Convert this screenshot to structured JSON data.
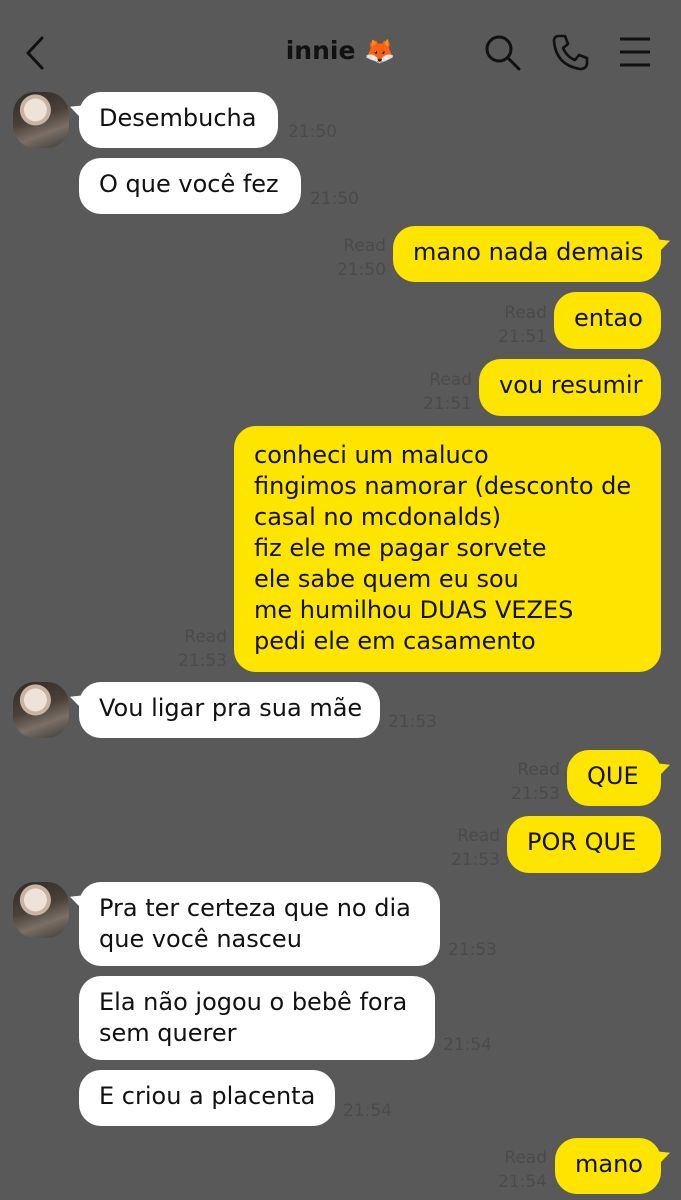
{
  "header": {
    "title": "innie 🦊",
    "icons": [
      "back-arrow-icon",
      "search-icon",
      "phone-icon",
      "menu-icon"
    ]
  },
  "colors": {
    "background": "#595959",
    "incoming": "#ffffff",
    "outgoing": "#fee500"
  },
  "messages": [
    {
      "side": "in",
      "lines": [
        "Desembucha"
      ],
      "time": "21:50"
    },
    {
      "side": "in",
      "lines": [
        "O que você fez"
      ],
      "time": "21:50"
    },
    {
      "side": "out",
      "lines": [
        "mano nada demais"
      ],
      "read": "Read",
      "time": "21:50"
    },
    {
      "side": "out",
      "lines": [
        "entao"
      ],
      "read": "Read",
      "time": "21:51"
    },
    {
      "side": "out",
      "lines": [
        "vou resumir"
      ],
      "read": "Read",
      "time": "21:51"
    },
    {
      "side": "out",
      "lines": [
        "conheci um maluco",
        "fingimos namorar (desconto de",
        "casal no mcdonalds)",
        "fiz ele me pagar sorvete",
        "ele sabe quem eu sou",
        "me humilhou DUAS VEZES",
        "pedi ele em casamento"
      ],
      "read": "Read",
      "time": "21:53"
    },
    {
      "side": "in",
      "lines": [
        "Vou ligar pra sua mãe"
      ],
      "time": "21:53"
    },
    {
      "side": "out",
      "lines": [
        "QUE"
      ],
      "read": "Read",
      "time": "21:53"
    },
    {
      "side": "out",
      "lines": [
        "POR QUE"
      ],
      "read": "Read",
      "time": "21:53"
    },
    {
      "side": "in",
      "lines": [
        "Pra ter certeza que no dia",
        "que você nasceu"
      ],
      "time": "21:53"
    },
    {
      "side": "in",
      "lines": [
        "Ela não jogou o bebê fora",
        "sem querer"
      ],
      "time": "21:54"
    },
    {
      "side": "in",
      "lines": [
        "E criou a placenta"
      ],
      "time": "21:54"
    },
    {
      "side": "out",
      "lines": [
        "mano"
      ],
      "read": "Read",
      "time": "21:54"
    }
  ]
}
